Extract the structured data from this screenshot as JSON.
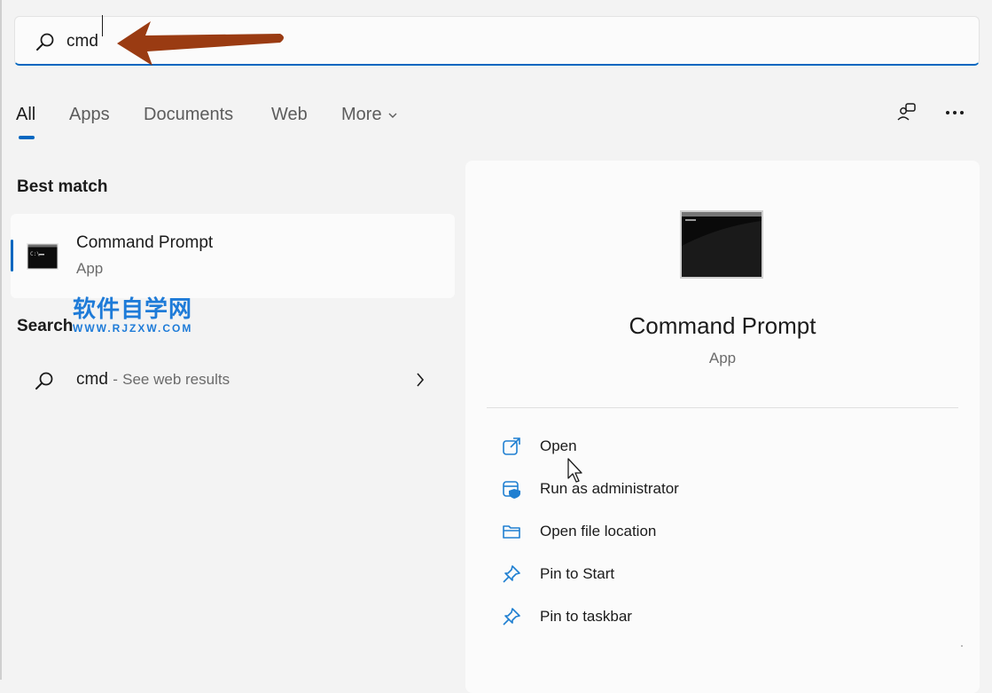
{
  "search": {
    "value": "cmd"
  },
  "tabs": [
    {
      "label": "All",
      "active": true
    },
    {
      "label": "Apps"
    },
    {
      "label": "Documents"
    },
    {
      "label": "Web"
    },
    {
      "label": "More"
    }
  ],
  "best_match": {
    "heading": "Best match",
    "name": "Command Prompt",
    "type": "App"
  },
  "search_web": {
    "heading": "Search",
    "query": "cmd",
    "separator": "-",
    "hint": "See web results"
  },
  "watermark": {
    "title": "软件自学网",
    "url": "WWW.RJZXW.COM"
  },
  "detail": {
    "name": "Command Prompt",
    "type": "App",
    "actions": [
      {
        "label": "Open",
        "icon": "open-external-icon"
      },
      {
        "label": "Run as administrator",
        "icon": "shield-admin-icon"
      },
      {
        "label": "Open file location",
        "icon": "folder-icon"
      },
      {
        "label": "Pin to Start",
        "icon": "pin-icon"
      },
      {
        "label": "Pin to taskbar",
        "icon": "pin-icon"
      }
    ]
  },
  "colors": {
    "accent": "#0067c0",
    "icon_blue": "#1f7fd1",
    "annotation_arrow": "#9a3b12",
    "watermark": "#1e7bd8"
  }
}
